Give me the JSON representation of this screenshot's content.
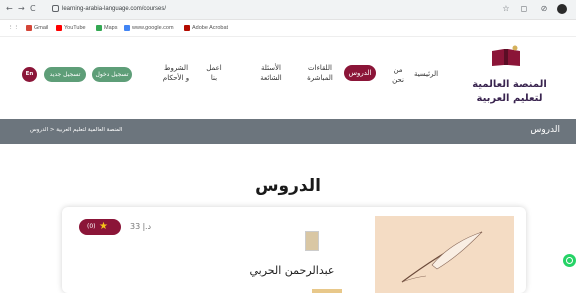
{
  "browser": {
    "url": "learning-arabia-language.com/courses/",
    "back": "←",
    "forward": "→",
    "reload": "C",
    "bookmarks": [
      {
        "label": "Gmail",
        "color": "#d44638"
      },
      {
        "label": "YouTube",
        "color": "#ff0000"
      },
      {
        "label": "Maps",
        "color": "#34a853"
      },
      {
        "label": "www.google.com",
        "color": "#4285f4"
      },
      {
        "label": "Adobe Acrobat",
        "color": "#b30b00"
      }
    ]
  },
  "logo": {
    "line1": "المنصة العالمية",
    "line2": "لتعليم العربية"
  },
  "nav": {
    "home": "الرئيسية",
    "about": "من نحن",
    "lessons": "الدروس",
    "live": "اللقاءات المباشرة",
    "faq": "الأسئلة الشائعة",
    "work": "اعمل بنا",
    "terms": "الشروط و الأحكام",
    "login": "تسجيل دخول",
    "register": "تسجيل جديد",
    "lang": "En"
  },
  "breadcrumb": {
    "title": "الدروس",
    "path": "المنصة العالمية لتعليم العربية < الدروس"
  },
  "page": {
    "title": "الدروس"
  },
  "card": {
    "rating_count": "(0)",
    "price": "33 د.إ",
    "author": "عبدالرحمن الحربي"
  },
  "colors": {
    "brand": "#8b1538",
    "green": "#5e9e78",
    "crumb": "#6c757d"
  }
}
